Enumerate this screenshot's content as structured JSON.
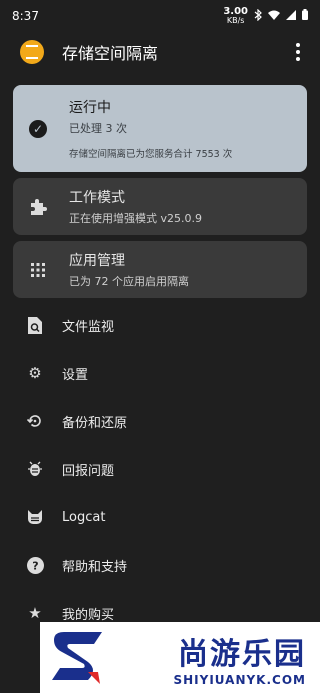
{
  "status_bar": {
    "time": "8:37",
    "speed_value": "3.00",
    "speed_unit": "KB/s"
  },
  "app_bar": {
    "title": "存储空间隔离",
    "menu_icon": "more-vert-icon"
  },
  "status_card": {
    "title": "运行中",
    "processed": "已处理 3 次",
    "summary": "存储空间隔离已为您服务合计 7553 次",
    "icon": "check-circle-icon"
  },
  "mode_card": {
    "title": "工作模式",
    "subtitle": "正在使用增强模式 v25.0.9",
    "icon": "puzzle-icon"
  },
  "apps_card": {
    "title": "应用管理",
    "subtitle": "已为 72 个应用启用隔离",
    "icon": "apps-grid-icon"
  },
  "menu": [
    {
      "label": "文件监视",
      "icon": "file-search-icon"
    },
    {
      "label": "设置",
      "icon": "gear-icon"
    },
    {
      "label": "备份和还原",
      "icon": "restore-icon"
    },
    {
      "label": "回报问题",
      "icon": "bug-icon"
    },
    {
      "label": "Logcat",
      "icon": "cat-icon"
    },
    {
      "label": "帮助和支持",
      "icon": "help-icon"
    },
    {
      "label": "我的购买",
      "icon": "star-icon"
    }
  ],
  "watermark": {
    "main": "尚游乐园",
    "sub": "SHIYIUANYK.COM"
  },
  "colors": {
    "background": "#1f1f1f",
    "status_card": "#b9c3cc",
    "card": "#3a3a3a",
    "logo": "#f2a91a",
    "watermark_text": "#1a2f8c"
  }
}
